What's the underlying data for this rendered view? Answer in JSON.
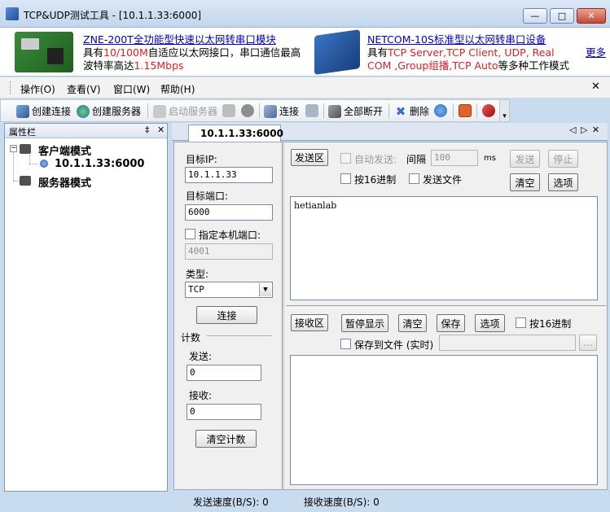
{
  "window": {
    "title": "TCP&UDP测试工具 - [10.1.1.33:6000]",
    "controls": {
      "minimize": "—",
      "maximize": "□",
      "close": "✕"
    }
  },
  "ads": {
    "ad1_title": "ZNE-200T全功能型快速以太网转串口模块",
    "ad1_line2_a": "具有",
    "ad1_line2_b": "10/100M",
    "ad1_line2_c": "自适应以太网接口，串口通信最高",
    "ad1_line3_a": "波特率高达",
    "ad1_line3_b": "1.15Mbps",
    "ad2_title": "NETCOM-10S标准型以太网转串口设备",
    "ad2_line2_a": "具有",
    "ad2_line2_b": "TCP Server,TCP Client, UDP, Real",
    "ad2_line3_a": "COM ,Group组播,TCP Auto",
    "ad2_line3_b": "等多种工作模式",
    "more": "更多"
  },
  "menu": {
    "operate": "操作(O)",
    "view": "查看(V)",
    "window": "窗口(W)",
    "help": "帮助(H)",
    "close": "✕"
  },
  "toolbar": {
    "create_conn": "创建连接",
    "create_server": "创建服务器",
    "start_server": "启动服务器",
    "connect": "连接",
    "disconnect_all": "全部断开",
    "delete": "删除"
  },
  "left_panel": {
    "title": "属性栏",
    "pin": "‡",
    "close": "✕",
    "client_mode": "客户端模式",
    "connection": "10.1.1.33:6000",
    "server_mode": "服务器模式",
    "expand": "−"
  },
  "tab": {
    "label": "10.1.1.33:6000",
    "nav": "◁ ▷ ✕"
  },
  "config": {
    "target_ip_label": "目标IP:",
    "target_ip": "10.1.1.33",
    "target_port_label": "目标端口:",
    "target_port": "6000",
    "local_port_label": "指定本机端口:",
    "local_port": "4001",
    "type_label": "类型:",
    "type_value": "TCP",
    "connect_btn": "连接",
    "count_label": "计数",
    "send_label": "发送:",
    "send_count": "0",
    "recv_label": "接收:",
    "recv_count": "0",
    "clear_count_btn": "清空计数"
  },
  "send_area": {
    "title": "发送区",
    "auto_send": "自动发送:",
    "interval_label": "间隔",
    "interval_value": "100",
    "interval_unit": "ms",
    "send_btn": "发送",
    "stop_btn": "停止",
    "hex_label": "按16进制",
    "send_file_label": "发送文件",
    "clear_btn": "清空",
    "options_btn": "选项",
    "content": "hetianlab"
  },
  "recv_area": {
    "title": "接收区",
    "pause_btn": "暂停显示",
    "clear_btn": "清空",
    "save_btn": "保存",
    "options_btn": "选项",
    "hex_label": "按16进制",
    "save_file_label": "保存到文件 (实时)",
    "browse_btn": "...",
    "content": ""
  },
  "status": {
    "send_speed": "发送速度(B/S): 0",
    "recv_speed": "接收速度(B/S): 0"
  },
  "colors": {
    "accent": "#0000cc",
    "highlight": "#e02020",
    "frame": "#c9dcef"
  }
}
